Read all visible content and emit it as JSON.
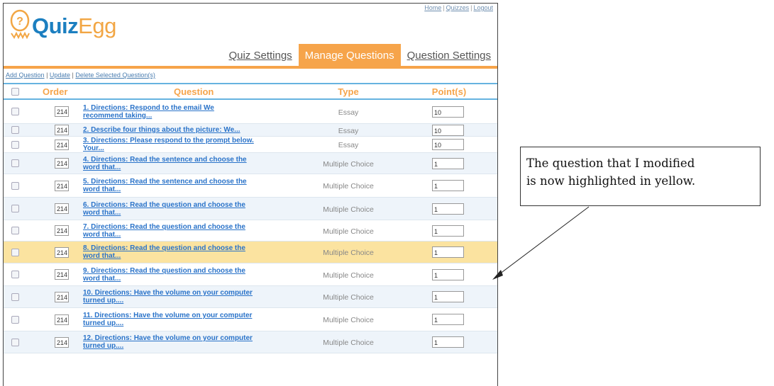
{
  "top_links": [
    "Home",
    "Quizzes",
    "Logout"
  ],
  "logo": {
    "part1": "Quiz",
    "part2": "Egg"
  },
  "tabs": [
    {
      "label": "Quiz Settings",
      "active": false
    },
    {
      "label": "Manage Questions",
      "active": true
    },
    {
      "label": "Question Settings",
      "active": false
    }
  ],
  "actions": {
    "add": "Add Question",
    "update": "Update",
    "delete": "Delete Selected Question(s)",
    "sep": "|"
  },
  "columns": {
    "order": "Order",
    "question": "Question",
    "type": "Type",
    "points": "Point(s)"
  },
  "rows": [
    {
      "order": "214",
      "line1": "1. Directions: Respond to the email We",
      "line2": "recommend taking...",
      "type": "Essay",
      "points": "10"
    },
    {
      "order": "214",
      "line1": "2. Describe four things about the picture: We...",
      "line2": "",
      "type": "Essay",
      "points": "10"
    },
    {
      "order": "214",
      "line1": "3. Directions: Please respond to the prompt below.",
      "line2": "Your...",
      "type": "Essay",
      "points": "10"
    },
    {
      "order": "214",
      "line1": "4. Directions: Read the sentence and choose the",
      "line2": "word that...",
      "type": "Multiple Choice",
      "points": "1"
    },
    {
      "order": "214",
      "line1": "5. Directions: Read the sentence and choose the",
      "line2": "word that...",
      "type": "Multiple Choice",
      "points": "1"
    },
    {
      "order": "214",
      "line1": "6. Directions: Read the question and choose the",
      "line2": "word that...",
      "type": "Multiple Choice",
      "points": "1"
    },
    {
      "order": "214",
      "line1": "7. Directions: Read the question and choose the",
      "line2": "word that...",
      "type": "Multiple Choice",
      "points": "1"
    },
    {
      "order": "214",
      "line1": "8. Directions: Read the question and choose the",
      "line2": "word that...",
      "type": "Multiple Choice",
      "points": "1"
    },
    {
      "order": "214",
      "line1": "9. Directions: Read the question and choose the",
      "line2": "word that...",
      "type": "Multiple Choice",
      "points": "1"
    },
    {
      "order": "214",
      "line1": "10. Directions: Have the volume on your computer",
      "line2": "turned up....",
      "type": "Multiple Choice",
      "points": "1"
    },
    {
      "order": "214",
      "line1": "11. Directions: Have the volume on your computer",
      "line2": "turned up....",
      "type": "Multiple Choice",
      "points": "1"
    },
    {
      "order": "214",
      "line1": "12. Directions: Have the volume on your computer",
      "line2": "turned up....",
      "type": "Multiple Choice",
      "points": "1"
    }
  ],
  "highlight_row_index": 7,
  "callout": {
    "line1": "The question that I modified",
    "line2": "is now highlighted in yellow."
  },
  "colors": {
    "accent": "#f6a44a",
    "brand_blue": "#1c7fc0",
    "highlight": "#fbe3a0",
    "rule": "#66b3e0"
  }
}
